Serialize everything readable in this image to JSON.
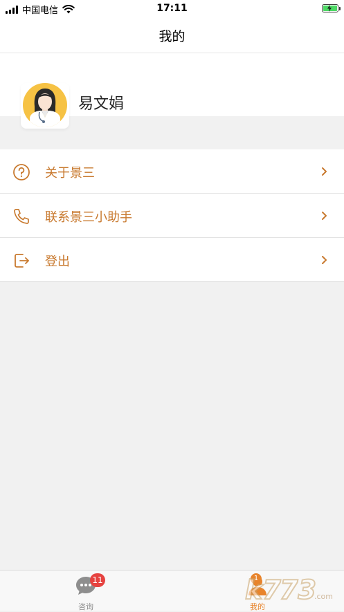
{
  "status_bar": {
    "carrier": "中国电信",
    "time": "17:11",
    "battery_color": "#4cd964"
  },
  "navbar": {
    "title": "我的"
  },
  "profile": {
    "name": "易文娟",
    "avatar_icon": "doctor-avatar-icon"
  },
  "menu": {
    "items": [
      {
        "label": "关于景三",
        "icon": "question-circle-icon"
      },
      {
        "label": "联系景三小助手",
        "icon": "phone-icon"
      },
      {
        "label": "登出",
        "icon": "logout-icon"
      }
    ]
  },
  "tabbar": {
    "tabs": [
      {
        "label": "咨询",
        "icon": "chat-bubble-icon",
        "badge": "11"
      },
      {
        "label": "我的",
        "icon": "person-icon",
        "badge": "1"
      }
    ]
  },
  "colors": {
    "accent": "#c8792e",
    "tab_active": "#e8842c",
    "badge": "#e64340",
    "background": "#f1f1f1"
  },
  "watermark": {
    "text": "k7 k73.com",
    "brand": "k73"
  }
}
